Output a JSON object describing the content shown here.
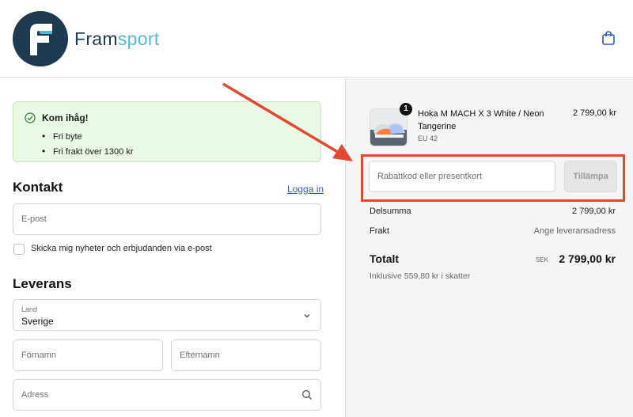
{
  "header": {
    "brand_part1": "Fram",
    "brand_part2": "sport",
    "logo_icon": "brand-logo-icon",
    "cart_icon": "shopping-bag-icon"
  },
  "notice": {
    "title": "Kom ihåg!",
    "items": [
      "Fri byte",
      "Fri frakt över 1300 kr"
    ]
  },
  "contact": {
    "heading": "Kontakt",
    "login_link": "Logga in",
    "email_placeholder": "E-post",
    "newsletter_label": "Skicka mig nyheter och erbjudanden via e-post"
  },
  "delivery": {
    "heading": "Leverans",
    "country_label": "Land",
    "country_value": "Sverige",
    "first_name_placeholder": "Förnamn",
    "last_name_placeholder": "Efternamn",
    "address_placeholder": "Adress"
  },
  "summary": {
    "product": {
      "quantity": "1",
      "name": "Hoka M MACH X 3 White / Neon Tangerine",
      "variant": "EU 42",
      "price": "2 799,00 kr"
    },
    "discount_placeholder": "Rabattkod eller presentkort",
    "apply_label": "Tillämpa",
    "subtotal_label": "Delsumma",
    "subtotal_value": "2 799,00 kr",
    "shipping_label": "Frakt",
    "shipping_value": "Ange leveransadress",
    "total_label": "Totalt",
    "total_currency": "SEK",
    "total_value": "2 799,00 kr",
    "tax_note": "Inklusive 559,80 kr i skatter"
  },
  "colors": {
    "brand_dark": "#1f3a4f",
    "brand_light": "#55b8d8",
    "annotation_red": "#e04a30",
    "notice_bg": "#eaf8e6",
    "link": "#2a5fb8"
  }
}
